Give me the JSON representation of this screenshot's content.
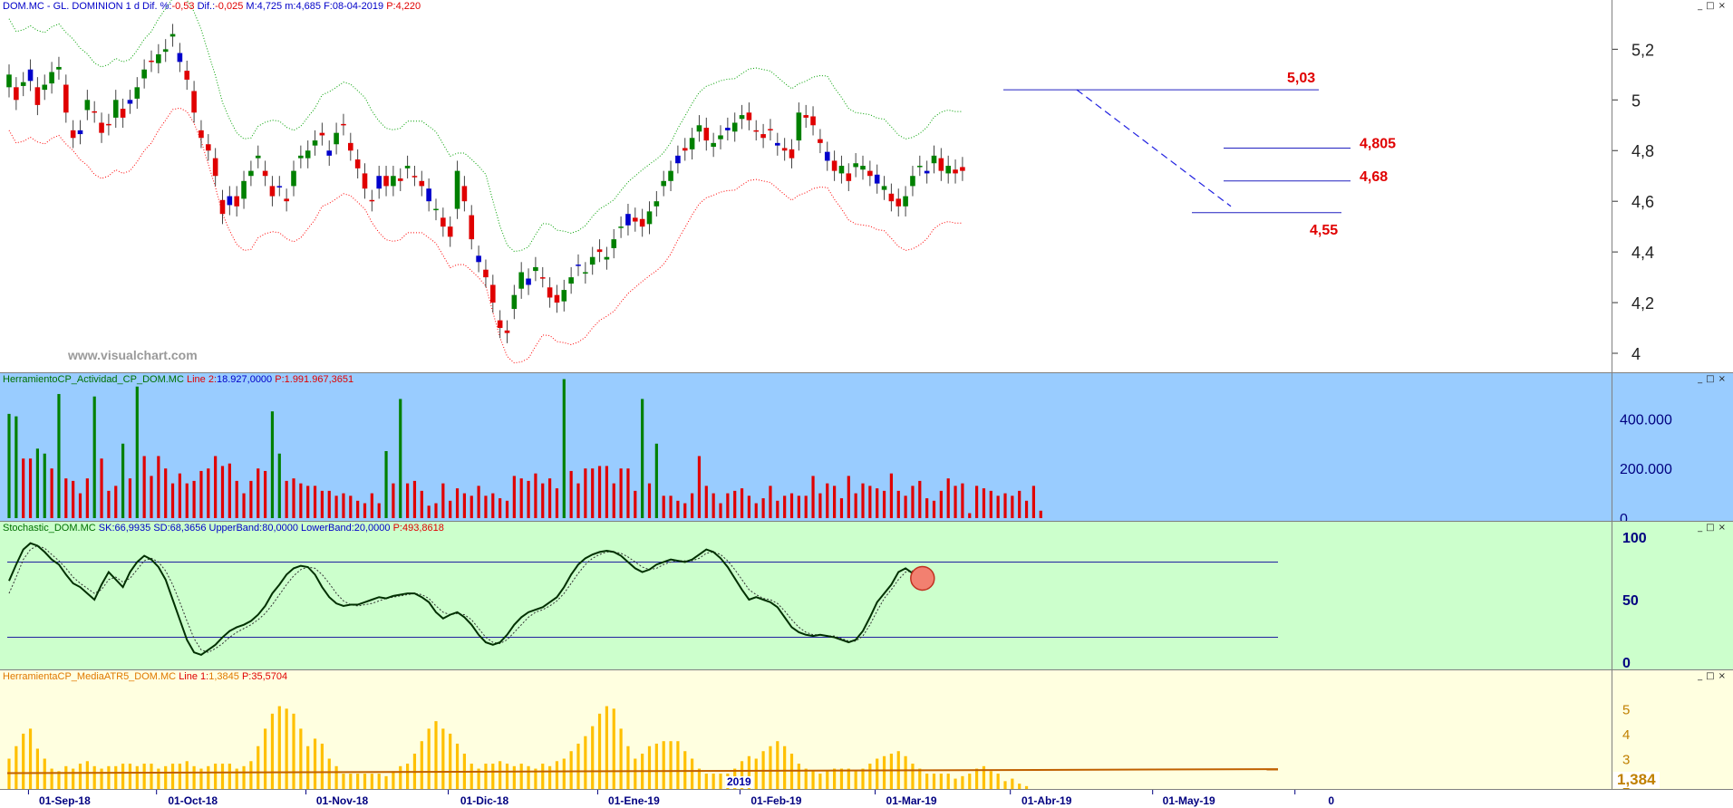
{
  "price_header": {
    "symbol": "DOM.MC - GL. DOMINION",
    "period": "1 d",
    "dif_pct_label": "Dif. %:",
    "dif_pct": "-0,53",
    "dif_label": "Dif.:",
    "dif": "-0,025",
    "max_label": "M:",
    "max": "4,725",
    "min_label": "m:",
    "min": "4,685",
    "date_label": "F:",
    "date": "08-04-2019",
    "price_label": "P:",
    "price": "4,220"
  },
  "watermark": "www.visualchart.com",
  "window_buttons": "_□×",
  "volume_header": {
    "name": "HerramientoCP_Actividad_CP_DOM.MC",
    "line_label": "Line 2:",
    "line": "18.927,0000",
    "p_label": "P:",
    "p": "1.991.967,3651"
  },
  "stoch_header": {
    "name": "Stochastic_DOM.MC",
    "sk_label": "SK:",
    "sk": "66,9935",
    "sd_label": "SD:",
    "sd": "68,3656",
    "ub_label": "UpperBand:",
    "ub": "80,0000",
    "lb_label": "LowerBand:",
    "lb": "20,0000",
    "p_label": "P:",
    "p": "493,8618"
  },
  "atr_header": {
    "name": "HerramientaCP_MediaATR5_DOM.MC",
    "line_label": "Line 1:",
    "line": "1,3845",
    "p_label": "P:",
    "p": "35,5704"
  },
  "atr_last_value": "1,384",
  "year_marker": "2019",
  "colors": {
    "up": "#008000",
    "down": "#e00000",
    "neutral": "#0000cc",
    "upper_band": "#00a000",
    "lower_band": "#ff0000",
    "volume_bg": "#99ccff",
    "stoch_bg": "#ccffcc",
    "atr_bg": "#ffffe0",
    "atr_bar": "#ffc000",
    "atr_line": "#c06000"
  },
  "chart_data": [
    {
      "type": "candlestick",
      "ylim": [
        3.95,
        5.33
      ],
      "y_ticks": [
        "5,2",
        "5",
        "4,8",
        "4,6",
        "4,4",
        "4,2",
        "4"
      ],
      "y_values": [
        5.2,
        5.0,
        4.8,
        4.6,
        4.4,
        4.2,
        4.0
      ],
      "x_ticks": [
        "01-Sep-18",
        "01-Oct-18",
        "01-Nov-18",
        "01-Dic-18",
        "01-Ene-19",
        "01-Feb-19",
        "01-Mar-19",
        "01-Abr-19",
        "01-May-19",
        "0"
      ],
      "x_tick_index": [
        4,
        22,
        43,
        63,
        84,
        104,
        123,
        142,
        162,
        182
      ],
      "levels": [
        {
          "label": "5,03",
          "value": 5.04
        },
        {
          "label": "4,805",
          "value": 4.81
        },
        {
          "label": "4,68",
          "value": 4.68
        },
        {
          "label": "4,55",
          "value": 4.555
        }
      ],
      "closes": [
        5.1,
        5.0,
        5.07,
        5.12,
        4.98,
        5.06,
        5.11,
        5.13,
        4.95,
        4.85,
        4.88,
        5.0,
        4.95,
        4.87,
        4.9,
        5.0,
        4.93,
        5.0,
        5.05,
        5.12,
        5.15,
        5.18,
        5.2,
        5.26,
        5.15,
        5.08,
        4.95,
        4.85,
        4.8,
        4.7,
        4.55,
        4.62,
        4.58,
        4.68,
        4.72,
        4.78,
        4.7,
        4.62,
        4.66,
        4.6,
        4.72,
        4.78,
        4.8,
        4.84,
        4.86,
        4.78,
        4.87,
        4.9,
        4.8,
        4.73,
        4.65,
        4.6,
        4.7,
        4.66,
        4.7,
        4.68,
        4.74,
        4.7,
        4.66,
        4.6,
        4.57,
        4.5,
        4.46,
        4.72,
        4.6,
        4.45,
        4.36,
        4.3,
        4.2,
        4.1,
        4.08,
        4.23,
        4.32,
        4.27,
        4.34,
        4.3,
        4.22,
        4.2,
        4.25,
        4.3,
        4.35,
        4.32,
        4.38,
        4.4,
        4.38,
        4.45,
        4.5,
        4.55,
        4.52,
        4.5,
        4.56,
        4.6,
        4.68,
        4.72,
        4.78,
        4.8,
        4.85,
        4.9,
        4.84,
        4.83,
        4.86,
        4.88,
        4.91,
        4.94,
        4.92,
        4.88,
        4.85,
        4.88,
        4.82,
        4.8,
        4.77,
        4.95,
        4.93,
        4.9,
        4.83,
        4.76,
        4.72,
        4.74,
        4.68,
        4.75,
        4.74,
        4.7,
        4.67,
        4.66,
        4.6,
        4.58,
        4.62,
        4.7,
        4.74,
        4.72,
        4.78,
        4.72,
        4.74,
        4.71,
        4.72
      ],
      "title": "",
      "xlabel": "",
      "ylabel": ""
    },
    {
      "type": "bar",
      "ylim": [
        0,
        540000
      ],
      "y_ticks": [
        "400.000",
        "200.000",
        "0"
      ],
      "y_values": [
        400000,
        200000,
        0
      ],
      "values": [
        420000,
        410000,
        240000,
        240000,
        280000,
        260000,
        200000,
        500000,
        160000,
        150000,
        100000,
        160000,
        490000,
        240000,
        110000,
        130000,
        300000,
        160000,
        530000,
        250000,
        170000,
        250000,
        200000,
        140000,
        180000,
        140000,
        150000,
        190000,
        200000,
        250000,
        210000,
        220000,
        150000,
        100000,
        150000,
        200000,
        190000,
        430000,
        260000,
        150000,
        160000,
        140000,
        130000,
        130000,
        110000,
        110000,
        90000,
        100000,
        90000,
        70000,
        60000,
        100000,
        60000,
        270000,
        140000,
        480000,
        140000,
        150000,
        110000,
        50000,
        60000,
        140000,
        70000,
        120000,
        100000,
        90000,
        130000,
        90000,
        100000,
        80000,
        70000,
        170000,
        160000,
        150000,
        180000,
        140000,
        160000,
        120000,
        560000,
        190000,
        140000,
        200000,
        200000,
        210000,
        210000,
        140000,
        200000,
        200000,
        110000,
        480000,
        140000,
        300000,
        90000,
        90000,
        70000,
        60000,
        100000,
        250000,
        130000,
        100000,
        60000,
        100000,
        110000,
        120000,
        90000,
        60000,
        80000,
        130000,
        70000,
        90000,
        100000,
        90000,
        90000,
        170000,
        100000,
        140000,
        130000,
        80000,
        170000,
        100000,
        140000,
        130000,
        120000,
        110000,
        180000,
        110000,
        90000,
        130000,
        150000,
        80000,
        70000,
        110000,
        160000,
        130000,
        140000,
        20000,
        130000,
        120000,
        110000,
        90000,
        100000,
        90000,
        110000,
        70000,
        130000,
        30000
      ],
      "title": "",
      "xlabel": "",
      "ylabel": ""
    },
    {
      "type": "line",
      "ylim": [
        -2,
        102
      ],
      "y_ticks": [
        "100",
        "50",
        "0"
      ],
      "y_values": [
        100,
        50,
        0
      ],
      "bands": [
        80,
        20
      ],
      "sk": [
        65,
        78,
        90,
        95,
        93,
        88,
        82,
        78,
        70,
        63,
        60,
        55,
        50,
        62,
        72,
        66,
        60,
        72,
        80,
        85,
        82,
        76,
        66,
        50,
        34,
        18,
        8,
        6,
        10,
        14,
        20,
        25,
        28,
        30,
        33,
        38,
        45,
        55,
        62,
        70,
        75,
        77,
        76,
        70,
        60,
        52,
        47,
        45,
        46,
        46,
        48,
        50,
        52,
        51,
        53,
        54,
        55,
        55,
        52,
        48,
        40,
        35,
        38,
        40,
        36,
        30,
        22,
        16,
        14,
        16,
        22,
        30,
        36,
        40,
        42,
        44,
        48,
        52,
        60,
        70,
        78,
        83,
        86,
        88,
        89,
        88,
        85,
        80,
        75,
        72,
        74,
        78,
        80,
        82,
        81,
        80,
        82,
        86,
        90,
        88,
        83,
        76,
        67,
        58,
        50,
        52,
        50,
        48,
        44,
        36,
        28,
        24,
        22,
        21,
        22,
        21,
        20,
        18,
        16,
        18,
        25,
        36,
        48,
        55,
        62,
        72,
        75,
        71,
        67
      ],
      "sd": [
        55,
        68,
        82,
        90,
        93,
        91,
        86,
        81,
        75,
        68,
        63,
        59,
        55,
        58,
        66,
        68,
        64,
        67,
        74,
        81,
        83,
        80,
        73,
        62,
        48,
        33,
        19,
        10,
        8,
        11,
        15,
        20,
        24,
        27,
        30,
        34,
        39,
        46,
        54,
        62,
        69,
        74,
        76,
        75,
        70,
        63,
        55,
        49,
        46,
        45,
        46,
        47,
        49,
        51,
        52,
        53,
        54,
        55,
        54,
        51,
        45,
        40,
        38,
        39,
        38,
        34,
        27,
        20,
        16,
        15,
        18,
        24,
        30,
        36,
        40,
        42,
        45,
        49,
        55,
        63,
        71,
        78,
        83,
        86,
        88,
        88,
        87,
        84,
        80,
        76,
        74,
        75,
        78,
        80,
        81,
        81,
        81,
        83,
        87,
        88,
        86,
        81,
        74,
        66,
        58,
        54,
        51,
        50,
        47,
        41,
        34,
        28,
        24,
        22,
        22,
        21,
        21,
        19,
        17,
        17,
        21,
        30,
        41,
        51,
        58,
        66,
        72,
        73,
        68
      ],
      "title": "",
      "xlabel": "",
      "ylabel": ""
    },
    {
      "type": "bar",
      "ylim": [
        1.75,
        6.1
      ],
      "y_ticks": [
        "5",
        "4",
        "3",
        "2"
      ],
      "y_values": [
        5,
        4,
        3,
        2
      ],
      "values": [
        3.0,
        3.5,
        4.0,
        4.2,
        3.4,
        3.0,
        2.6,
        2.5,
        2.7,
        2.6,
        2.8,
        2.9,
        2.7,
        2.6,
        2.7,
        2.7,
        2.8,
        2.8,
        2.7,
        2.8,
        2.8,
        2.6,
        2.7,
        2.8,
        2.8,
        2.9,
        2.7,
        2.6,
        2.7,
        2.8,
        2.8,
        2.8,
        2.6,
        2.7,
        2.9,
        3.5,
        4.2,
        4.8,
        5.1,
        5.0,
        4.8,
        4.2,
        3.5,
        3.8,
        3.6,
        3.0,
        2.7,
        2.4,
        2.4,
        2.4,
        2.4,
        2.4,
        2.4,
        2.3,
        2.5,
        2.7,
        2.8,
        3.2,
        3.7,
        4.2,
        4.5,
        4.2,
        4.0,
        3.6,
        3.2,
        2.8,
        2.6,
        2.8,
        2.8,
        2.9,
        2.8,
        2.7,
        2.8,
        2.7,
        2.6,
        2.8,
        2.7,
        2.9,
        3.0,
        3.3,
        3.6,
        3.9,
        4.3,
        4.8,
        5.1,
        5.0,
        4.2,
        3.5,
        3.0,
        3.2,
        3.5,
        3.6,
        3.7,
        3.7,
        3.7,
        3.3,
        3.0,
        2.6,
        2.4,
        2.4,
        2.4,
        2.4,
        2.6,
        2.9,
        3.1,
        3.0,
        3.3,
        3.5,
        3.7,
        3.5,
        3.2,
        2.8,
        2.6,
        2.5,
        2.4,
        2.5,
        2.6,
        2.6,
        2.6,
        2.5,
        2.6,
        2.8,
        3.0,
        3.1,
        3.2,
        3.3,
        3.1,
        2.8,
        2.6,
        2.4,
        2.4,
        2.4,
        2.4,
        2.2,
        2.3,
        2.4,
        2.6,
        2.7,
        2.5,
        2.4,
        2.1,
        2.2,
        2.0,
        1.9
      ],
      "avg": [
        2.42,
        2.58
      ],
      "title": "",
      "xlabel": "",
      "ylabel": ""
    }
  ]
}
